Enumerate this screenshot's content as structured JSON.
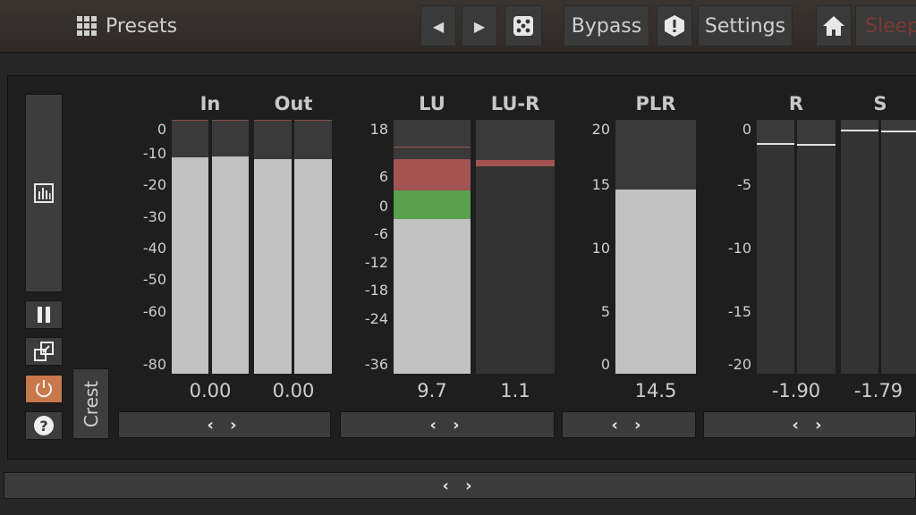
{
  "toolbar": {
    "presets_label": "Presets",
    "bypass_label": "Bypass",
    "settings_label": "Settings",
    "sleep_label": "Sleep",
    "prev_icon": "◀",
    "next_icon": "▶"
  },
  "side": {
    "crest_label": "Crest"
  },
  "meters": {
    "in": {
      "label": "In",
      "value": "0.00",
      "ticks": [
        "0",
        "-10",
        "-20",
        "-30",
        "-40",
        "-50",
        "-60",
        "-80"
      ],
      "levels": [
        0.855,
        0.857
      ]
    },
    "out": {
      "label": "Out",
      "value": "0.00",
      "levels": [
        0.85,
        0.85
      ]
    },
    "lu": {
      "label": "LU",
      "value": "9.7",
      "ticks": [
        "18",
        "6",
        "0",
        "-6",
        "-12",
        "-18",
        "-24",
        "-36"
      ]
    },
    "lur": {
      "label": "LU-R",
      "value": "1.1"
    },
    "plr": {
      "label": "PLR",
      "value": "14.5",
      "ticks": [
        "20",
        "15",
        "10",
        "5",
        "0"
      ],
      "level": 14.5
    },
    "r": {
      "label": "R",
      "value": "-1.90",
      "ticks": [
        "0",
        "-5",
        "-10",
        "-15",
        "-20"
      ]
    },
    "s": {
      "label": "S",
      "value": "-1.79"
    }
  },
  "scroll_label": "‹ ›",
  "colors": {
    "accent_orange": "#c8784a",
    "lu_red": "#a45353",
    "lu_green": "#5aa04e",
    "meter_fill": "#c2c2c2"
  }
}
